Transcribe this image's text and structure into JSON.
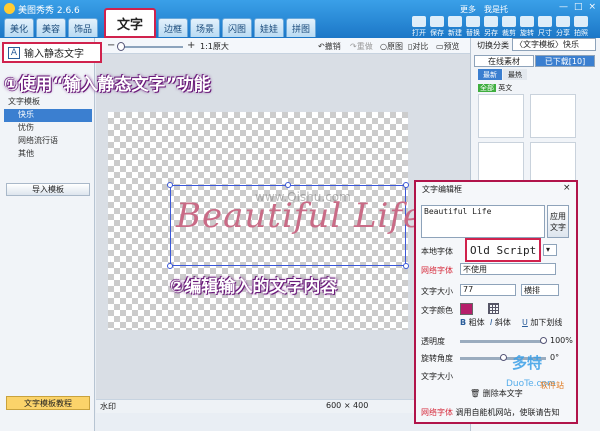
{
  "app": {
    "title": "美图秀秀 2.6.6",
    "user_links": [
      "更多",
      "我是托"
    ]
  },
  "window_controls": [
    "—",
    "□",
    "×"
  ],
  "main_tabs": [
    {
      "label": "美化"
    },
    {
      "label": "美容"
    },
    {
      "label": "饰品"
    },
    {
      "label": "文字",
      "active": true
    },
    {
      "label": "边框"
    },
    {
      "label": "场景"
    },
    {
      "label": "闪图"
    },
    {
      "label": "娃娃"
    },
    {
      "label": "拼图"
    }
  ],
  "toolbar": [
    "打开",
    "保存",
    "新建",
    "替换",
    "另存",
    "裁剪",
    "旋转",
    "尺寸",
    "分享",
    "拍照"
  ],
  "subbar": {
    "zoom_minus": "−",
    "zoom_plus": "+",
    "zoom_ratio": "1:1原大",
    "undo": "撤销",
    "redo": "重做",
    "original": "原图",
    "compare": "对比",
    "preview": "预览"
  },
  "left_panel": {
    "static_text_button": "输入静态文字",
    "static_icon": "A",
    "tree": [
      "文字模板",
      "快乐",
      "忧伤",
      "网络流行语",
      "其他"
    ],
    "import_button": "导入模板",
    "tutorial_button": "文字模板教程"
  },
  "annotations": {
    "step1": "①使用“输入静态文字”功能",
    "step2": "②编辑输入的文字内容"
  },
  "canvas": {
    "text": "Beautiful Life",
    "watermark_label": "水印",
    "size_label": "600 × 400"
  },
  "right_panel": {
    "category_label": "切换分类",
    "category_value": "〈文字模板〉快乐",
    "tabs": [
      "在线素材",
      "已下载[10]"
    ],
    "subtabs": [
      "最新",
      "最热"
    ],
    "filter": [
      "全部",
      "英文"
    ]
  },
  "dialog": {
    "title": "文字编辑框",
    "close": "×",
    "text_value": "Beautiful Life",
    "apply_button": "应用文字",
    "local_font_label": "本地字体",
    "local_font_value": "Old Script",
    "web_font_label": "网络字体",
    "web_font_value": "不使用",
    "size_label": "文字大小",
    "size_value": "77",
    "orientation_value": "横排",
    "color_label": "文字颜色",
    "bold": "粗体",
    "italic": "斜体",
    "underline": "加下划线",
    "opacity_label": "透明度",
    "opacity_value": "100%",
    "rotate_label": "旋转角度",
    "rotate_value": "0°",
    "text_size_label2": "文字大小",
    "delete_button": "删除本文字",
    "hint_label": "网络字体",
    "hint_text": "调用自能机网站，使联请告知",
    "colors": {
      "text_color": "#b51e6a"
    }
  },
  "brand": {
    "mark": "多特",
    "sub": "DuoTe.com",
    "site": "软件站"
  }
}
